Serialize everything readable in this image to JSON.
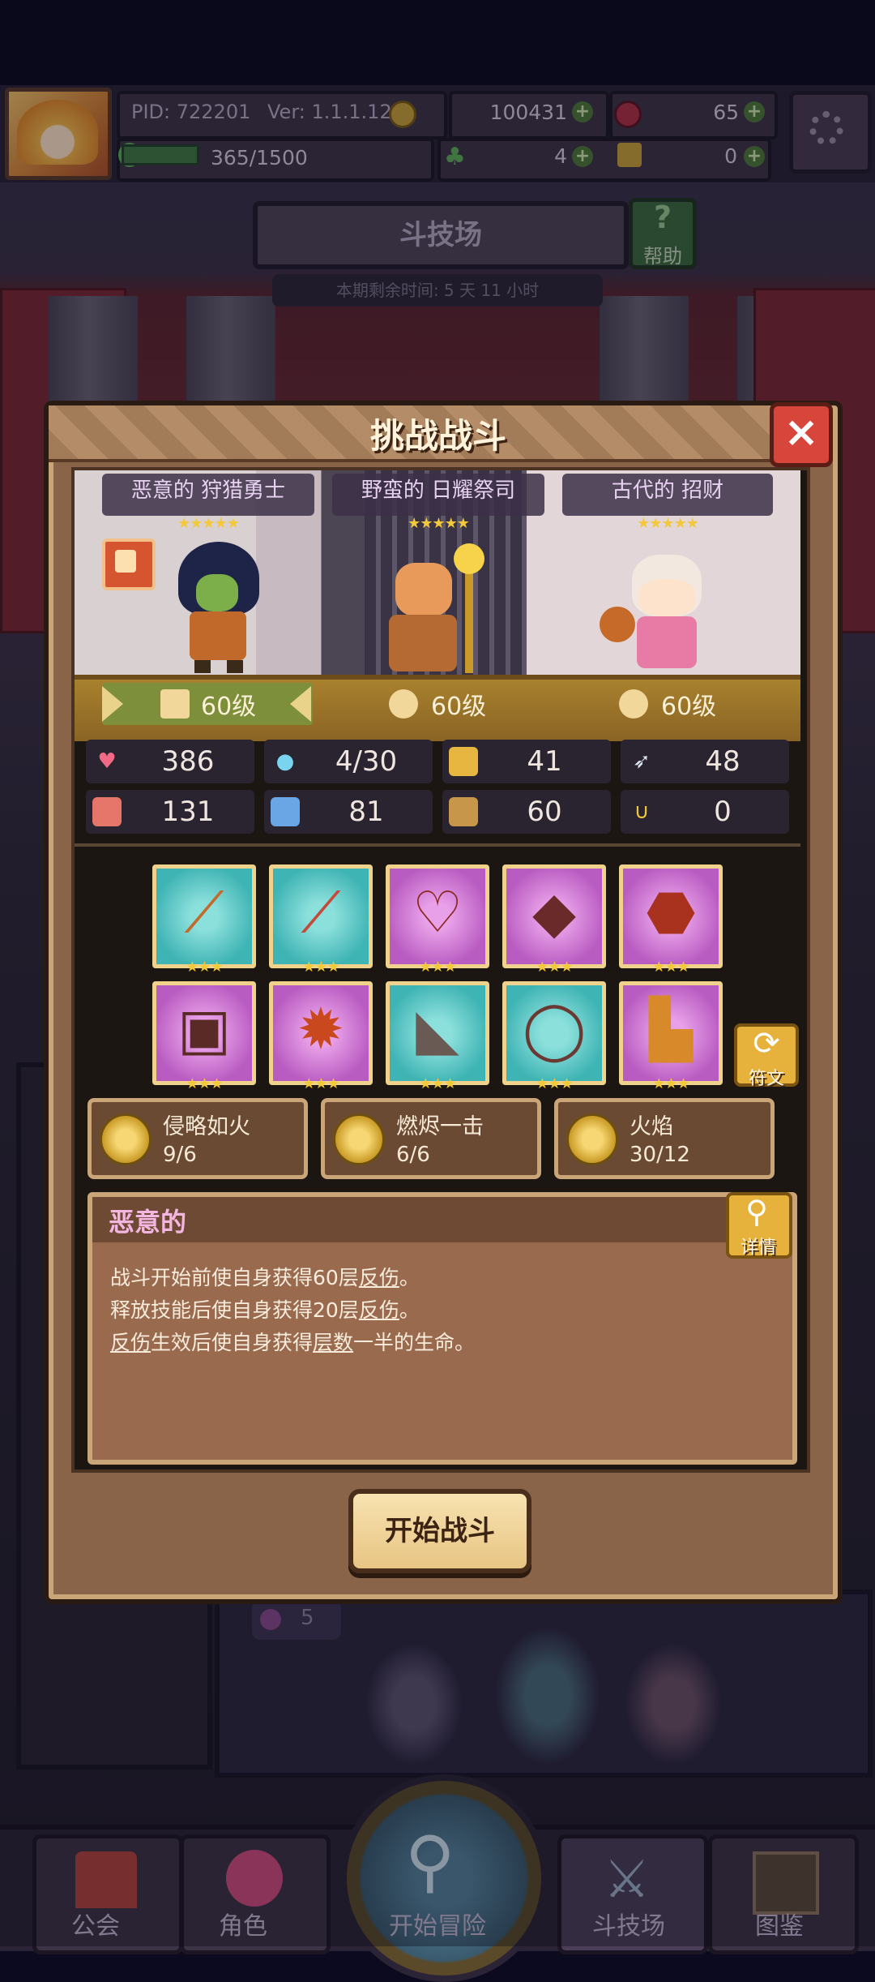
{
  "hud": {
    "pid": "PID: 722201",
    "version": "Ver: 1.1.1.12",
    "gold": "100431",
    "gems": "65",
    "energy": "365/1500",
    "clover": "4",
    "keys": "0"
  },
  "arena": {
    "title": "斗技场",
    "help_label": "帮助",
    "season_remaining": "本期剩余时间: 5 天 11 小时"
  },
  "modal": {
    "title": "挑战战斗",
    "close_icon": "close-icon",
    "fighters": [
      {
        "name": "恶意的 狩猎勇士",
        "stars": "★★★★★",
        "level": "60级"
      },
      {
        "name": "野蛮的 日耀祭司",
        "stars": "★★★★★",
        "level": "60级"
      },
      {
        "name": "古代的 招财",
        "stars": "★★★★★",
        "level": "60级"
      }
    ],
    "stats": [
      {
        "icon": "heart-icon",
        "value": "386"
      },
      {
        "icon": "mana-drop-icon",
        "value": "4/30"
      },
      {
        "icon": "shield-icon",
        "value": "41"
      },
      {
        "icon": "wing-speed-icon",
        "value": "48"
      },
      {
        "icon": "fist-icon",
        "value": "131"
      },
      {
        "icon": "book-icon",
        "value": "81"
      },
      {
        "icon": "boot-icon",
        "value": "60"
      },
      {
        "icon": "horseshoe-icon",
        "value": "0"
      }
    ],
    "equipment": [
      {
        "icon": "staff-icon",
        "rarity": "teal",
        "stars": "★★★"
      },
      {
        "icon": "dagger-icon",
        "rarity": "teal",
        "stars": "★★★"
      },
      {
        "icon": "heart-amulet-icon",
        "rarity": "pink",
        "stars": "★★★"
      },
      {
        "icon": "gem-ring-icon",
        "rarity": "pink",
        "stars": "★★★"
      },
      {
        "icon": "crystal-icon",
        "rarity": "pink",
        "stars": "★★★"
      },
      {
        "icon": "armor-icon",
        "rarity": "pink",
        "stars": "★★★"
      },
      {
        "icon": "spiked-armor-icon",
        "rarity": "pink",
        "stars": "★★★"
      },
      {
        "icon": "gauntlet-icon",
        "rarity": "teal",
        "stars": "★★★"
      },
      {
        "icon": "ring-icon",
        "rarity": "teal",
        "stars": "★★★"
      },
      {
        "icon": "boots-icon",
        "rarity": "pink",
        "stars": "★★★"
      }
    ],
    "rune_label": "符文",
    "skills": [
      {
        "name": "侵略如火",
        "count": "9/6"
      },
      {
        "name": "燃烬一击",
        "count": "6/6"
      },
      {
        "name": "火焰",
        "count": "30/12"
      }
    ],
    "trait": {
      "title": "恶意的",
      "detail_label": "详情",
      "line1_a": "战斗开始前使自身获得60层",
      "line1_b": "反伤",
      "line1_c": "。",
      "line2_a": "释放技能后使自身获得20层",
      "line2_b": "反伤",
      "line2_c": "。",
      "line3_a": "反伤",
      "line3_b": "生效后使自身获得",
      "line3_c": "层数",
      "line3_d": "一半的生命。"
    },
    "start_button": "开始战斗"
  },
  "background": {
    "badge_value": "5"
  },
  "nav": {
    "guild": "公会",
    "character": "角色",
    "adventure": "开始冒险",
    "arena": "斗技场",
    "codex": "图鉴"
  }
}
